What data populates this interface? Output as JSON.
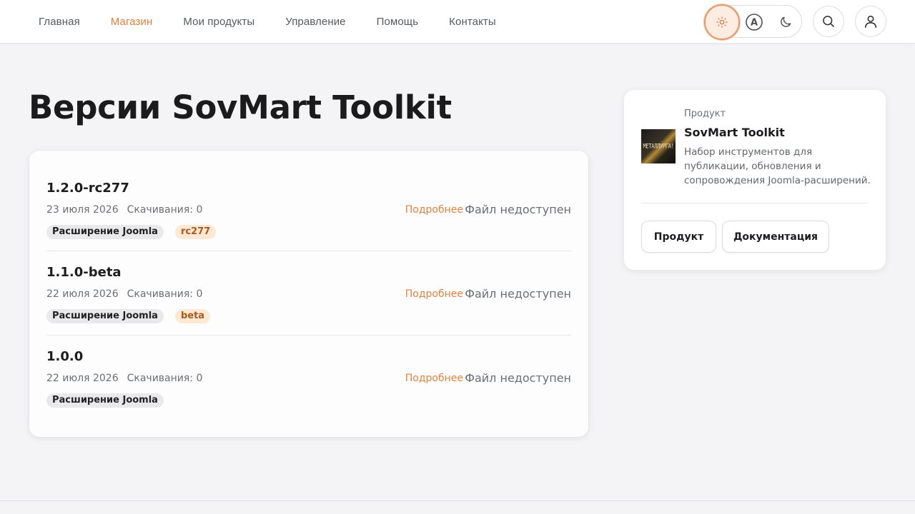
{
  "nav": {
    "items": [
      {
        "label": "Главная",
        "active": false
      },
      {
        "label": "Магазин",
        "active": true
      },
      {
        "label": "Мои продукты",
        "active": false
      },
      {
        "label": "Управление",
        "active": false
      },
      {
        "label": "Помощь",
        "active": false
      },
      {
        "label": "Контакты",
        "active": false
      }
    ]
  },
  "theme": {
    "selected": "light",
    "options": [
      "sun-icon",
      "auto-icon",
      "moon-icon"
    ],
    "auto_letter": "A"
  },
  "header_icons": [
    "search-icon",
    "user-icon"
  ],
  "page": {
    "title": "Версии SovMart Toolkit"
  },
  "versions": [
    {
      "name": "1.2.0-rc277",
      "date": "23 июля 2026",
      "downloads": "Скачивания: 0",
      "more": "Подробнее",
      "status": "Файл недоступен",
      "tags": [
        {
          "label": "Расширение Joomla",
          "style": "grey"
        },
        {
          "label": "rc277",
          "style": "orange"
        }
      ]
    },
    {
      "name": "1.1.0-beta",
      "date": "22 июля 2026",
      "downloads": "Скачивания: 0",
      "more": "Подробнее",
      "status": "Файл недоступен",
      "tags": [
        {
          "label": "Расширение Joomla",
          "style": "grey"
        },
        {
          "label": "beta",
          "style": "orange"
        }
      ]
    },
    {
      "name": "1.0.0",
      "date": "22 июля 2026",
      "downloads": "Скачивания: 0",
      "more": "Подробнее",
      "status": "Файл недоступен",
      "tags": [
        {
          "label": "Расширение Joomla",
          "style": "grey"
        }
      ]
    }
  ],
  "product": {
    "label": "Продукт",
    "name": "SovMart Toolkit",
    "description": "Набор инструментов для публикации, обновления и сопровождения Joomla-расширений.",
    "thumb_text": "МЕТАЛЛУРГА!",
    "buttons": {
      "product": "Продукт",
      "docs": "Документация"
    }
  },
  "colors": {
    "accent": "#e0803d",
    "background": "#f4f4f6",
    "tag_orange_bg": "#fde9d3",
    "tag_grey_bg": "#e9e9ec"
  }
}
